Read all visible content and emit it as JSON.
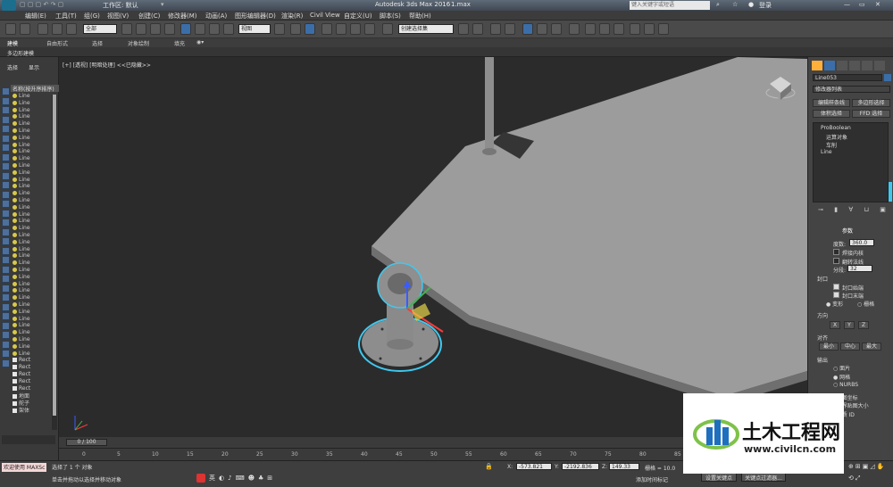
{
  "title_bar": {
    "app_title": "Autodesk 3ds Max 2016",
    "file_name": "1.max",
    "workspace_label": "工作区: 默认",
    "search_placeholder": "键入关键字或短语",
    "login_label": "登录"
  },
  "menu": [
    "编辑(E)",
    "工具(T)",
    "组(G)",
    "视图(V)",
    "创建(C)",
    "修改器(M)",
    "动画(A)",
    "图形编辑器(D)",
    "渲染(R)",
    "Civil View",
    "自定义(U)",
    "脚本(S)",
    "帮助(H)"
  ],
  "toolbar": {
    "filter_value": "全部",
    "view_dropdown": "视图",
    "selection_set_placeholder": "创建选择集"
  },
  "ribbon_tabs": [
    "建模",
    "自由形式",
    "选择",
    "对象绘制",
    "填充"
  ],
  "ribbon_subtab": "多边形建模",
  "scene_explorer": {
    "tabs": [
      "选择",
      "显示"
    ],
    "header": "名称(按升序排序)",
    "items": [
      "Line",
      "Line",
      "Line",
      "Line",
      "Line",
      "Line",
      "Line",
      "Line",
      "Line",
      "Line",
      "Line",
      "Line",
      "Line",
      "Line",
      "Line",
      "Line",
      "Line",
      "Line",
      "Line",
      "Line",
      "Line",
      "Line",
      "Line",
      "Line",
      "Line",
      "Line",
      "Line",
      "Line",
      "Line",
      "Line",
      "Line",
      "Line",
      "Line",
      "Line",
      "Line",
      "Line",
      "Line",
      "Line",
      "Rect",
      "Rect",
      "Rect",
      "Rect",
      "Rect",
      "地面",
      "舵子",
      "架体"
    ]
  },
  "viewport_label": "[+] [透视] [明暗处理] <<已隐藏>>",
  "command_panel": {
    "object_name": "Line053",
    "modifier_list": "修改器列表",
    "buttons": [
      "编辑样条线",
      "多边形选择",
      "体积选择",
      "FFD 选择"
    ],
    "stack": [
      "ProBoolean",
      "运算对象",
      "车削",
      "Line"
    ],
    "rollout_params": "参数",
    "degrees_label": "度数:",
    "degrees_value": "360.0",
    "weld_core": "焊接内核",
    "flip_normals": "翻转法线",
    "segments_label": "分段:",
    "segments_value": "32",
    "cap_label": "封口",
    "cap_start": "封口始端",
    "cap_end": "封口末端",
    "morph": "变形",
    "grid": "栅格",
    "direction_label": "方向",
    "dir_x": "X",
    "dir_y": "Y",
    "dir_z": "Z",
    "align_label": "对齐",
    "align_min": "最小",
    "align_center": "中心",
    "align_max": "最大",
    "output_label": "输出",
    "out_patch": "面片",
    "out_mesh": "网格",
    "out_nurbs": "NURBS",
    "gen_coords": "生成贴图坐标",
    "real_world": "真实世界贴图大小",
    "gen_matid": "生成材质 ID",
    "smooth": "平滑"
  },
  "timeline": {
    "frame_label": "0 / 100",
    "ticks": [
      "0",
      "5",
      "10",
      "15",
      "20",
      "25",
      "30",
      "35",
      "40",
      "45",
      "50",
      "55",
      "60",
      "65",
      "70",
      "75",
      "80",
      "85",
      "90"
    ]
  },
  "status": {
    "welcome": "欢迎使用 MAXSc",
    "selected": "选择了 1 个 对象",
    "hint": "单击并拖动以选择并移动对象",
    "x_label": "X:",
    "x_value": "-573.821",
    "y_label": "Y:",
    "y_value": "-2192.836",
    "z_label": "Z:",
    "z_value": "149.33",
    "grid_label": "栅格 = 10.0",
    "add_time_tag": "添加时间标记",
    "set_key": "设置关键点",
    "key_filter": "关键点过滤器...",
    "ime_label": "英"
  },
  "watermark": {
    "brand": "土木工程网",
    "url": "www.civilcn.com"
  },
  "colors": {
    "accent_blue": "#3b6ea8",
    "selection_cyan": "#3fc8ef",
    "viewport_bg": "#2b2b2b",
    "model_grey": "#9b9b9b"
  }
}
